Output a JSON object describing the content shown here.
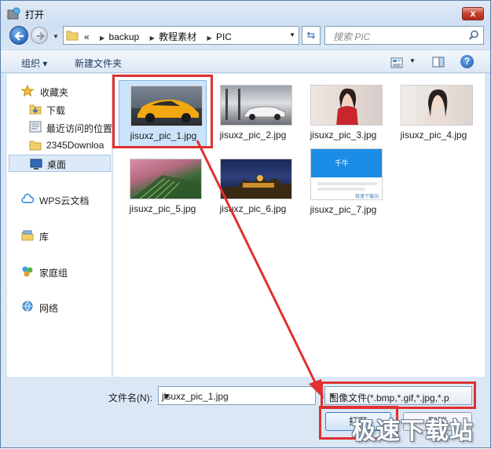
{
  "window": {
    "title": "打开",
    "close_label": "x"
  },
  "address": {
    "segments": [
      "backup",
      "教程素材",
      "PIC"
    ],
    "prefix": "«"
  },
  "search": {
    "placeholder": "搜索 PIC"
  },
  "toolbar": {
    "organize_label": "组织 ▾",
    "new_folder_label": "新建文件夹",
    "help_label": "?"
  },
  "sidebar": {
    "items": [
      {
        "label": "收藏夹",
        "icon": "star-icon"
      },
      {
        "label": "下载",
        "icon": "download-folder-icon"
      },
      {
        "label": "最近访问的位置",
        "icon": "recent-icon"
      },
      {
        "label": "2345Downloa",
        "icon": "folder-icon"
      },
      {
        "label": "桌面",
        "icon": "desktop-icon"
      },
      {
        "label": "WPS云文档",
        "icon": "cloud-icon"
      },
      {
        "label": "库",
        "icon": "library-icon"
      },
      {
        "label": "家庭组",
        "icon": "homegroup-icon"
      },
      {
        "label": "网络",
        "icon": "network-icon"
      }
    ]
  },
  "files": [
    {
      "name": "jisuxz_pic_1.jpg"
    },
    {
      "name": "jisuxz_pic_2.jpg"
    },
    {
      "name": "jisuxz_pic_3.jpg"
    },
    {
      "name": "jisuxz_pic_4.jpg"
    },
    {
      "name": "jisuxz_pic_5.jpg"
    },
    {
      "name": "jisuxz_pic_6.jpg"
    },
    {
      "name": "jisuxz_pic_7.jpg"
    }
  ],
  "thumb_text": {
    "qianniu_label": "千牛",
    "qianniu_caption": "极速下载站"
  },
  "bottom": {
    "filename_label": "文件名(N):",
    "filename_value": "jisuxz_pic_1.jpg",
    "filter_value": "图像文件(*.bmp,*.gif,*.jpg,*.p",
    "open_label": "打开",
    "cancel_label": "取消"
  },
  "watermark": "极速下载站",
  "colors": {
    "highlight": "#e03030",
    "selection": "#cce4fb",
    "accent": "#2b6cc0"
  }
}
